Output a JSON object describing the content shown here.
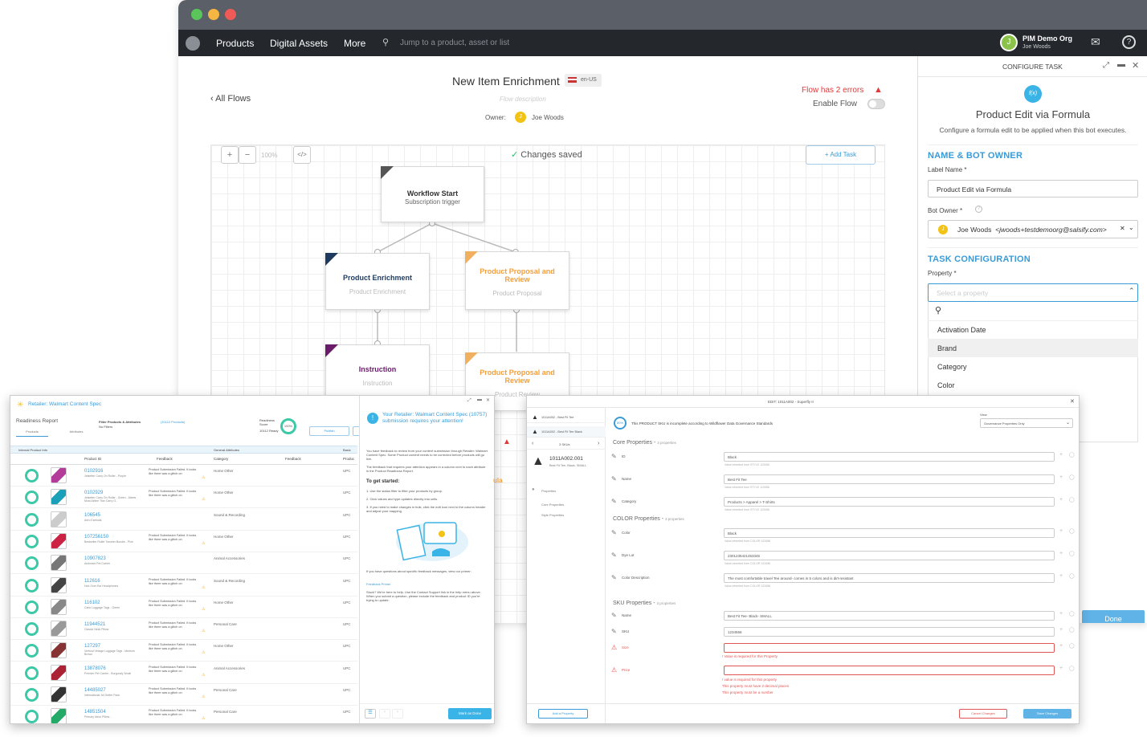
{
  "nav": {
    "products": "Products",
    "digital_assets": "Digital Assets",
    "more": "More",
    "search_placeholder": "Jump to a product, asset or list",
    "org": "PIM Demo Org",
    "user": "Joe Woods",
    "avatar_initial": "J"
  },
  "flow": {
    "back": "All Flows",
    "title": "New Item Enrichment",
    "locale": "en-US",
    "description_placeholder": "Flow description",
    "owner_label": "Owner:",
    "owner_name": "Joe Woods",
    "owner_initial": "J",
    "errors": "Flow has 2 errors",
    "enable": "Enable Flow",
    "zoom": "100%",
    "saved": "Changes saved",
    "add_task": "+ Add Task",
    "nodes": [
      {
        "title": "Workflow Start",
        "subtitle": "Subscription trigger"
      },
      {
        "title": "Product Enrichment",
        "subtitle": "Product Enrichment"
      },
      {
        "title": "Product Proposal and Review",
        "subtitle": "Product Proposal"
      },
      {
        "title": "Instruction",
        "subtitle": "Instruction"
      },
      {
        "title": "Product Proposal and Review",
        "subtitle": "Product Review"
      }
    ],
    "partial_text": "ula"
  },
  "config": {
    "header": "CONFIGURE TASK",
    "icon_text": "f(x)",
    "title": "Product Edit via Formula",
    "subtitle": "Configure a formula edit to be applied when this bot executes.",
    "section1": "NAME & BOT OWNER",
    "label_name_lbl": "Label Name *",
    "label_name_val": "Product Edit via Formula",
    "bot_owner_lbl": "Bot Owner *",
    "bot_owner_name": "Joe Woods",
    "bot_owner_email": "<jwoods+testdemoorg@salsify.com>",
    "section2": "TASK CONFIGURATION",
    "property_lbl": "Property *",
    "property_placeholder": "Select a property",
    "options": [
      "Activation Date",
      "Brand",
      "Category",
      "Color"
    ],
    "done": "Done"
  },
  "left": {
    "retailer": "Retailer: Walmart Content Spec",
    "report": "Readiness Report",
    "filter": "Filter Products & Attributes",
    "filter_count": "(10112 Products)",
    "no_filters": "No Filters",
    "tab1": "Products",
    "tab2": "Attributes",
    "score_label": "Readiness Score",
    "score_count": "10112 Ready",
    "score": "100%",
    "publish": "Publish",
    "group1": "Internal Product Info",
    "group2": "General Attributes",
    "group3": "Basic",
    "col_product_id": "Product ID",
    "col_feedback": "Feedback",
    "col_category": "Category",
    "col_feedback2": "Feedback",
    "col_product": "Produc",
    "rows": [
      {
        "id": "0102916",
        "desc": "Jetsetter Carry On Roller - Purple",
        "fb": "Product Submission Failed. It looks like there was a glitch on",
        "cat": "Home Other",
        "upc": "UPC"
      },
      {
        "id": "0102929",
        "desc": "Jetsetter Carry On Roller - Green - Meets Most Airline Trav Carry O..",
        "fb": "Product Submission Failed. It looks like there was a glitch on",
        "cat": "Home Other",
        "upc": "UPC"
      },
      {
        "id": "106545",
        "desc": "Aero Earbuds",
        "fb": "",
        "cat": "Sound & Recording",
        "upc": "UPC"
      },
      {
        "id": "107256150",
        "desc": "Bestseller Rollet Traveler Bundle - Pink",
        "fb": "Product Submission Failed. It looks like there was a glitch on",
        "cat": "Home Other",
        "upc": "UPC"
      },
      {
        "id": "10907823",
        "desc": "Airdream Pet Carrier",
        "fb": "",
        "cat": "Animal Accessories",
        "upc": "UPC"
      },
      {
        "id": "112616",
        "desc": "Hub Over Ear Headphones",
        "fb": "Product Submission Failed. It looks like there was a glitch on",
        "cat": "Sound & Recording",
        "upc": "UPC"
      },
      {
        "id": "116102",
        "desc": "Cabo Luggage Tags - Green",
        "fb": "Product Submission Failed. It looks like there was a glitch on",
        "cat": "Home Other",
        "upc": "UPC"
      },
      {
        "id": "11944521",
        "desc": "Classic Neck Pillow",
        "fb": "Product Submission Failed. It looks like there was a glitch on",
        "cat": "Personal Care",
        "upc": "UPC"
      },
      {
        "id": "127297",
        "desc": "Vertical Vintage Luggage Tags - Medium Brown",
        "fb": "Product Submission Failed. It looks like there was a glitch on",
        "cat": "Home Other",
        "upc": "UPC"
      },
      {
        "id": "13878076",
        "desc": "Premier Pet Carrier - Burgundy Small",
        "fb": "Product Submission Failed. It looks like there was a glitch on",
        "cat": "Animal Accessories",
        "upc": "UPC"
      },
      {
        "id": "14485027",
        "desc": "International Jet Setter Pack",
        "fb": "Product Submission Failed. It looks like there was a glitch on",
        "cat": "Personal Care",
        "upc": "UPC"
      },
      {
        "id": "14851504",
        "desc": "Primary Neck Pillow -",
        "fb": "Product Submission Failed. It looks like there was a glitch on",
        "cat": "Personal Care",
        "upc": "UPC"
      }
    ],
    "notice_title": "Your Retailer: Walmart Content Spec (10757) submission requires your attention!",
    "notice_body1": "You have feedback to review from your content submission through Retailer: Walmart Content Spec. Some Product content needs to be corrected before products will go live.",
    "notice_body2": "The feedback that requires your attention appears in a column next to each attribute in the Product Readiness Report.",
    "get_started": "To get started:",
    "steps": [
      "1. Use the status filter to filter your products by group.",
      "2. Click values and type updates directly into cells.",
      "3. If you need to make changes in bulk, click the edit icon next to the column header and adjust your mapping."
    ],
    "notice_body3": "If you have questions about specific feedback messages, view our primer:",
    "primer_link": "Feedback Primer",
    "notice_body4": "Stuck? We're here to help. Use the Contact Support link in the help menu above. When you submit a question, please include the feedback and product ID you're trying to update.",
    "mark_done": "Mark as Done"
  },
  "right": {
    "header": "EDIT: 1011A002 - Superfly II",
    "view_label": "View",
    "view_value": "Governance Properties Only",
    "banner": "This PRODUCT SKU is incomplete according to Wildflower Data Governance Standards",
    "score": "80%",
    "items": [
      "1011A002 - Best Fit Tee",
      "1011A002 - Best Fit Tee Black"
    ],
    "skus": "3 SKUs",
    "sku_id": "1011A002.001",
    "sku_name": "Best Fit Tee- Black- SMALL",
    "nav_props": "Properties",
    "nav_core": "Core Properties",
    "nav_style": "Style Properties",
    "core_section": "Core Properties",
    "core_count": "3 properties",
    "color_section": "COLOR Properties",
    "color_count": "3 properties",
    "sku_section": "SKU Properties",
    "sku_count": "3 properties",
    "fields": [
      {
        "label": "ID",
        "value": "Black",
        "hint": "Value inherited from STYLE 123456"
      },
      {
        "label": "Name",
        "value": "Best Fit Tee",
        "hint": "Value inherited from STYLE 123456"
      },
      {
        "label": "Category",
        "value": "Products > Apparel > T-Shirts",
        "hint": "Value inherited from STYLE 123456"
      },
      {
        "label": "Color",
        "value": "Black",
        "hint": "Value inherited from COLOR 123456"
      },
      {
        "label": "Dye Lot",
        "value": "2301235421453345",
        "hint": "Value inherited from COLOR 123456"
      },
      {
        "label": "Color Description",
        "value": "The most comfortable travel Tee around- comes in 5 colors and is dirt-resistant",
        "hint": "Value inherited from COLOR 123456"
      },
      {
        "label": "Name",
        "value": "Best Fit Tee- Black- SMALL",
        "hint": ""
      },
      {
        "label": "SKU",
        "value": "1234556",
        "hint": ""
      },
      {
        "label": "Size",
        "value": "",
        "hint": ""
      },
      {
        "label": "Price",
        "value": "",
        "hint": ""
      }
    ],
    "size_error": "! Value is required for this Property",
    "price_errors": [
      "! value is required for this property",
      "This property must have 2 decimal places",
      "This property must be a number"
    ],
    "add_property": "Add a Property",
    "cancel": "Cancel Changes",
    "save": "Save Changes"
  },
  "colors": {
    "accent": "#3a9bd6",
    "enrichment": "#1e3a5f",
    "proposal": "#f0b060",
    "instruction": "#6a1b6a",
    "error": "#e03a3a",
    "ready": "#3dc9a6"
  }
}
